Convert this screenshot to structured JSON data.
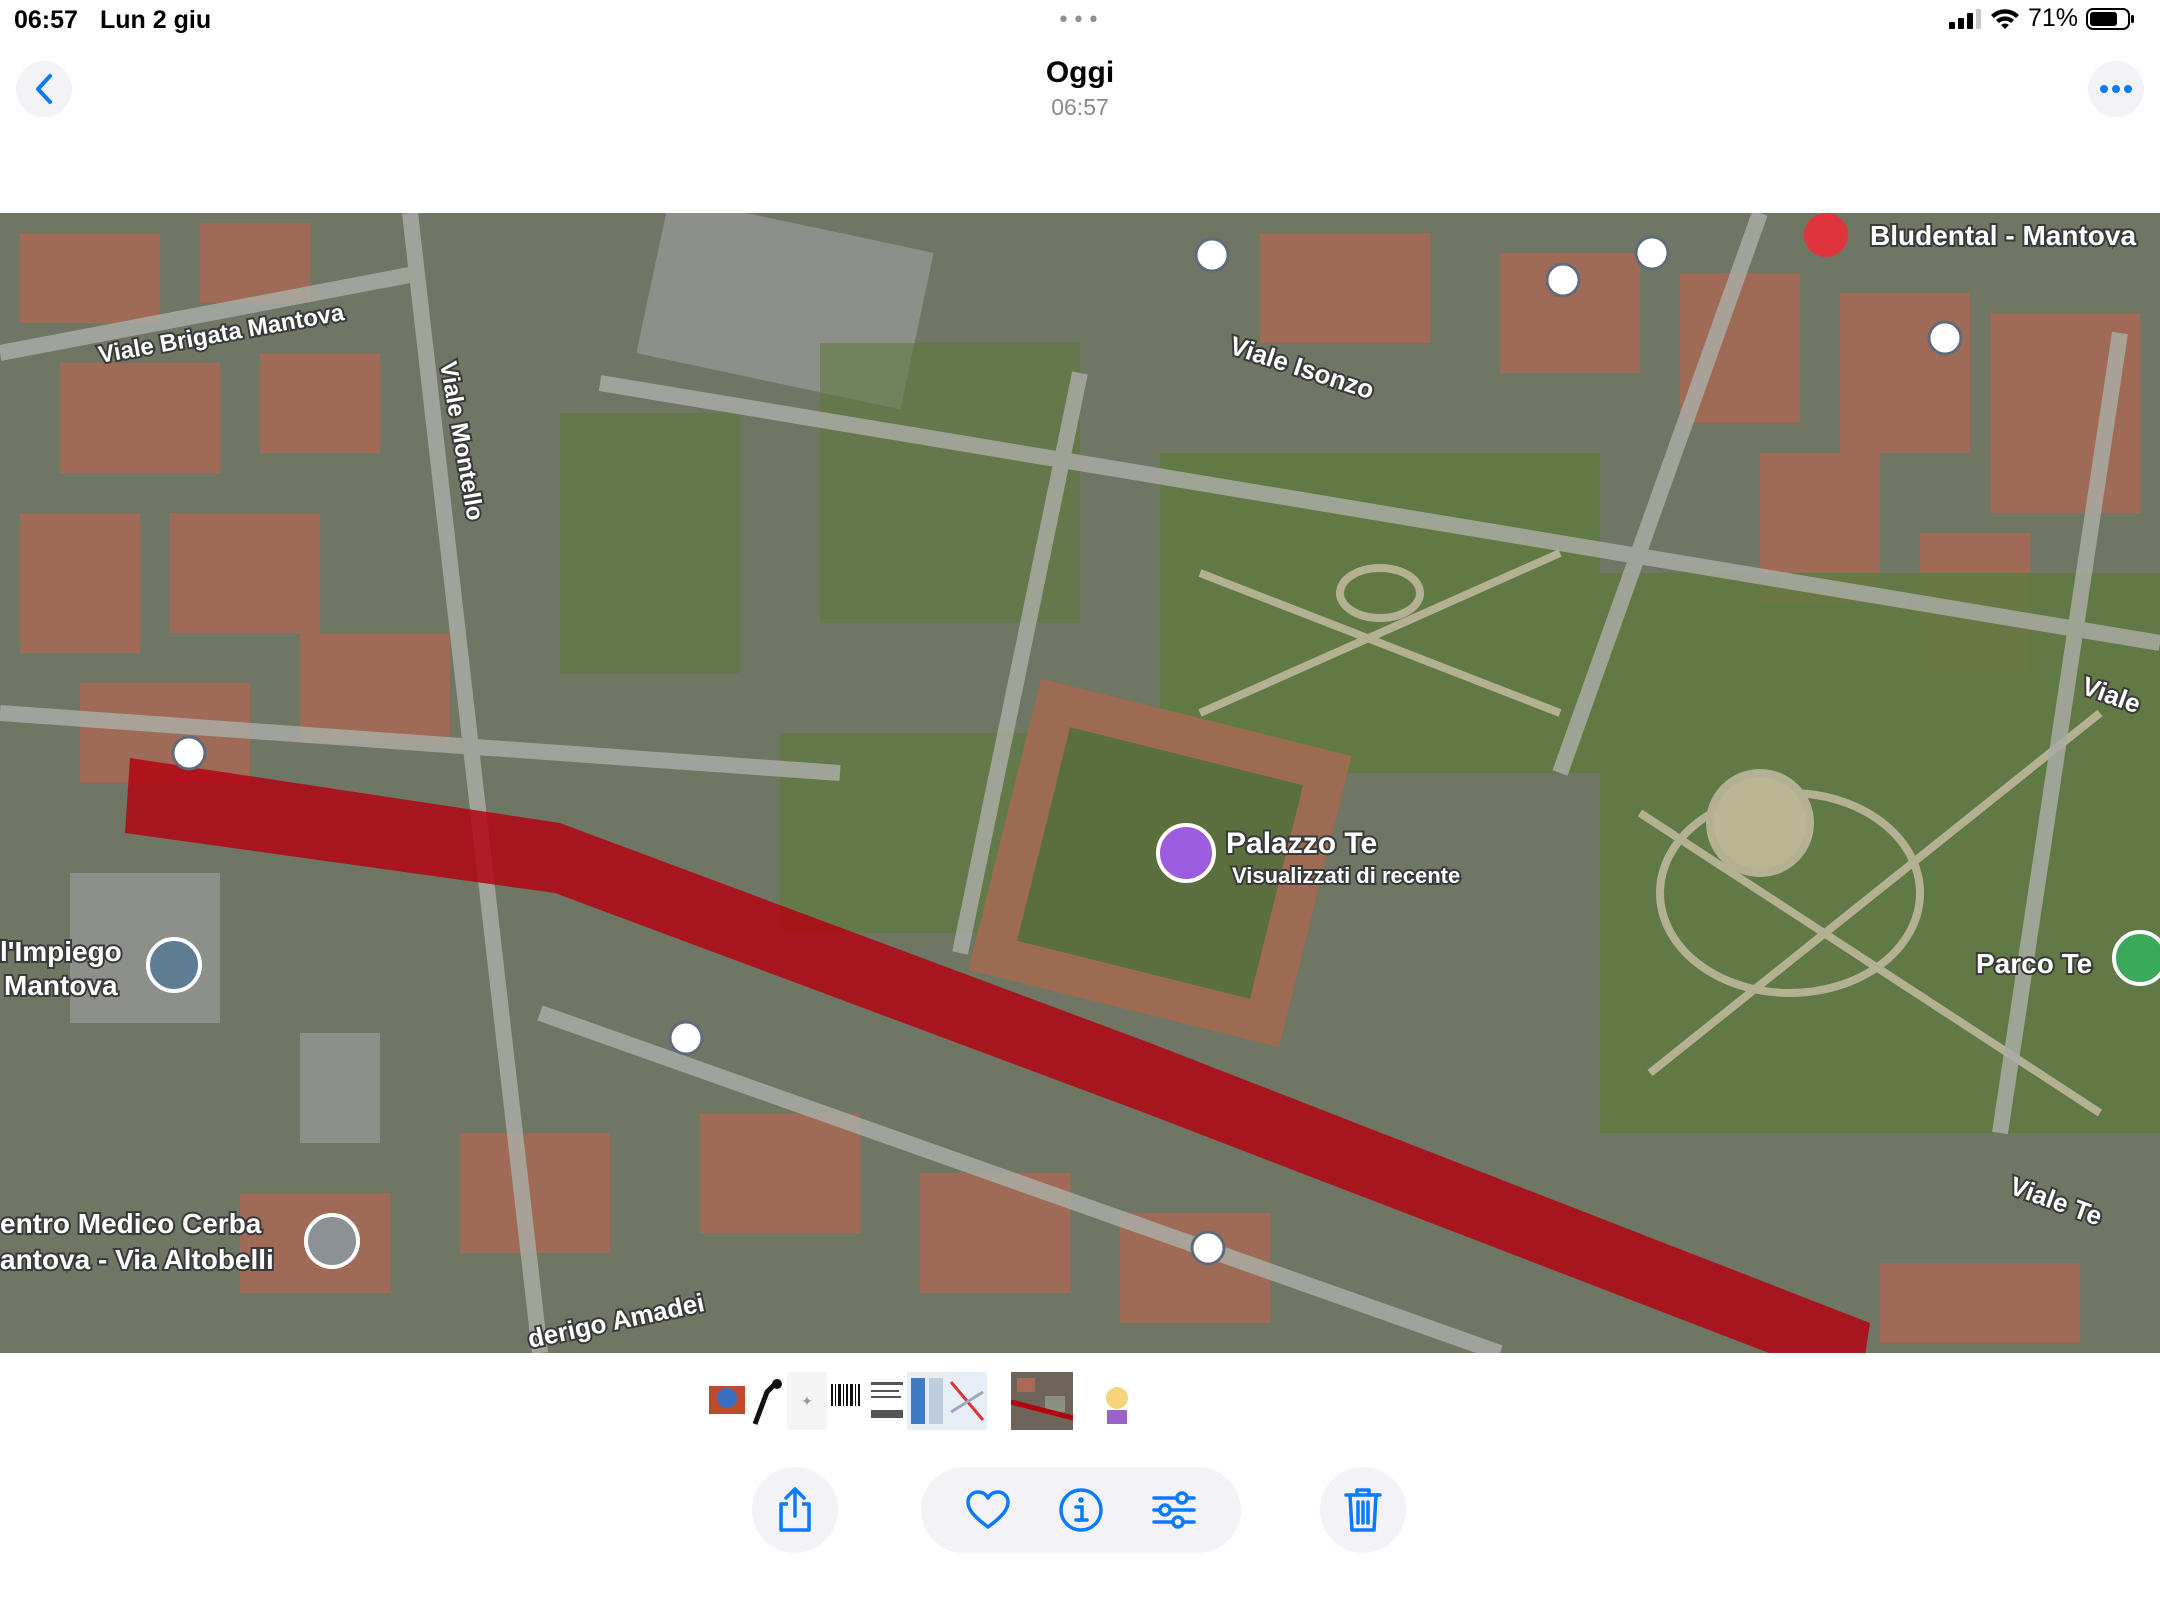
{
  "status_bar": {
    "time": "06:57",
    "date": "Lun 2 giu",
    "dots": "•••",
    "battery_pct": "71%"
  },
  "nav": {
    "title": "Oggi",
    "subtitle": "06:57"
  },
  "map": {
    "labels": {
      "brigata": "Viale Brigata Mantova",
      "montello": "Viale Montello",
      "isonzo": "Viale Isonzo",
      "bludental": "Bludental - Mantova",
      "viale_right": "Viale",
      "palazzo": "Palazzo Te",
      "recent": "Visualizzati di recente",
      "parco": "Parco Te",
      "viale_te": "Viale Te",
      "impiego1": "l'Impiego",
      "impiego2": "Mantova",
      "cerba1": "entro Medico Cerba",
      "cerba2": "antova - Via Altobelli",
      "amadei": "derigo Amadei"
    }
  },
  "thumbnails": [
    "thumb-1",
    "thumb-2",
    "thumb-3",
    "thumb-4",
    "thumb-5",
    "thumb-6",
    "thumb-7",
    "thumb-selected",
    "thumb-9"
  ],
  "colors": {
    "accent": "#0a7aff",
    "route": "#b3000f",
    "button_bg": "#f2f2f7"
  }
}
